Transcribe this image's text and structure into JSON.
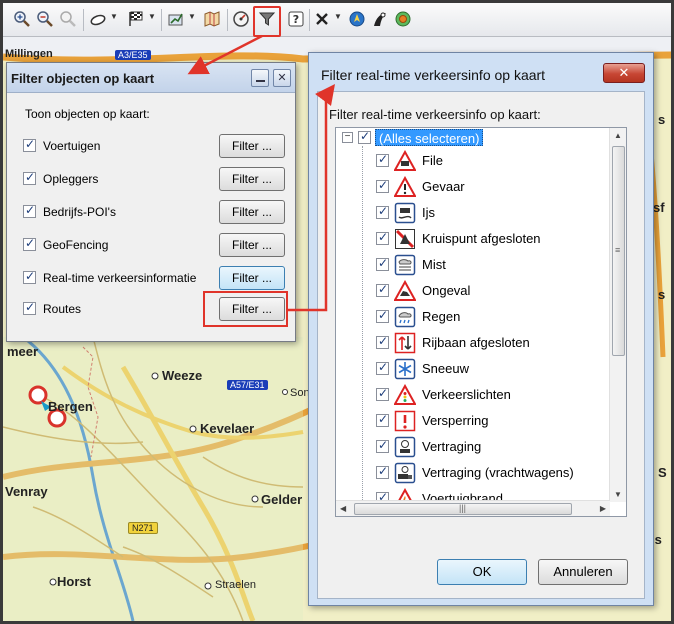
{
  "toolbar": {
    "icons": [
      "zoom-in-icon",
      "zoom-out-icon",
      "zoom-disabled-icon",
      "shape-icon",
      "finish-flag-icon",
      "route-edit-icon",
      "map-book-icon",
      "dashboard-icon",
      "filter-icon",
      "help-icon",
      "cross-icon",
      "navigation-icon",
      "driver-icon",
      "globe-icon"
    ]
  },
  "map": {
    "labels": {
      "millingen": "Millingen",
      "meer": "meer",
      "weeze": "Weeze",
      "bergen": "Bergen",
      "kevelaer": "Kevelaer",
      "venray": "Venray",
      "geldern": "Gelder",
      "horst": "Horst",
      "straelen": "Straelen",
      "sonsbeck": "Son",
      "edge1": "s",
      "edge2": "sf",
      "edge3": "s",
      "edge4": "S",
      "edge5": "Is"
    },
    "badges": {
      "a3e35": "A3/E35",
      "a57e31": "A57/E31",
      "n271": "N271"
    }
  },
  "filter_window": {
    "title": "Filter objecten op kaart",
    "subtitle": "Toon objecten op kaart:",
    "rows": [
      {
        "label": "Voertuigen",
        "button": "Filter ..."
      },
      {
        "label": "Opleggers",
        "button": "Filter ..."
      },
      {
        "label": "Bedrijfs-POI's",
        "button": "Filter ..."
      },
      {
        "label": "GeoFencing",
        "button": "Filter ..."
      },
      {
        "label": "Real-time verkeersinformatie",
        "button": "Filter ..."
      },
      {
        "label": "Routes",
        "button": "Filter ..."
      }
    ]
  },
  "traffic_dialog": {
    "title": "Filter real-time verkeersinfo op kaart",
    "subtitle": "Filter real-time verkeersinfo op kaart:",
    "select_all": "(Alles selecteren)",
    "items": [
      {
        "label": "File",
        "icon": "traffic-jam-icon"
      },
      {
        "label": "Gevaar",
        "icon": "danger-icon"
      },
      {
        "label": "Ijs",
        "icon": "ice-icon"
      },
      {
        "label": "Kruispunt afgesloten",
        "icon": "closed-junction-icon"
      },
      {
        "label": "Mist",
        "icon": "fog-icon"
      },
      {
        "label": "Ongeval",
        "icon": "accident-icon"
      },
      {
        "label": "Regen",
        "icon": "rain-icon"
      },
      {
        "label": "Rijbaan afgesloten",
        "icon": "lane-closed-icon"
      },
      {
        "label": "Sneeuw",
        "icon": "snow-icon"
      },
      {
        "label": "Verkeerslichten",
        "icon": "traffic-lights-icon"
      },
      {
        "label": "Versperring",
        "icon": "obstruction-icon"
      },
      {
        "label": "Vertraging",
        "icon": "delay-icon"
      },
      {
        "label": "Vertraging (vrachtwagens)",
        "icon": "truck-delay-icon"
      },
      {
        "label": "Voertuigbrand",
        "icon": "vehicle-fire-icon"
      }
    ],
    "ok_label": "OK",
    "cancel_label": "Annuleren"
  },
  "colors": {
    "highlight": "#e0342a",
    "selection": "#3399ff",
    "dialog_frame": "#cfe0f4"
  }
}
